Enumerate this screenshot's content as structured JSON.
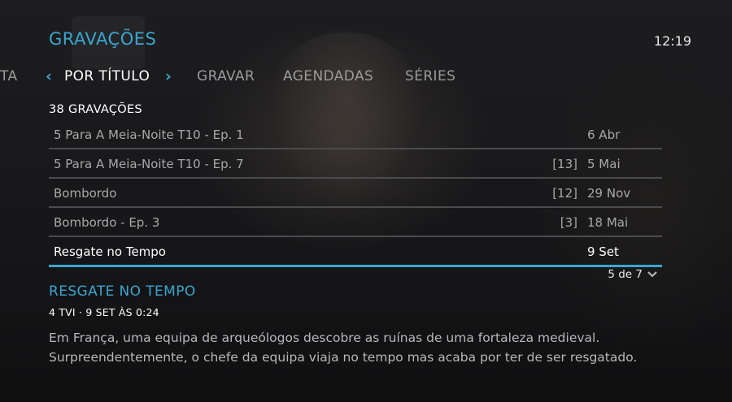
{
  "header": {
    "title": "GRAVAÇÕES",
    "clock": "12:19"
  },
  "tabs": {
    "prev_partial": "TA",
    "left_arrow": "‹",
    "active": "POR TÍTULO",
    "right_arrow": "›",
    "items": [
      "GRAVAR",
      "AGENDADAS",
      "SÉRIES"
    ]
  },
  "list": {
    "count_label": "38 GRAVAÇÕES",
    "rows": [
      {
        "title": "5 Para A Meia-Noite T10 - Ep. 1",
        "episodes": "",
        "date": "6 Abr"
      },
      {
        "title": "5 Para A Meia-Noite T10 - Ep. 7",
        "episodes": "[13]",
        "date": "5 Mai"
      },
      {
        "title": "Bombordo",
        "episodes": "[12]",
        "date": "29 Nov"
      },
      {
        "title": "Bombordo - Ep. 3",
        "episodes": "[3]",
        "date": "18 Mai"
      },
      {
        "title": "Resgate no Tempo",
        "episodes": "",
        "date": "9 Set"
      }
    ],
    "selected_index": 4,
    "pager": "5 de 7"
  },
  "detail": {
    "title": "RESGATE NO TEMPO",
    "meta": "4 TVI · 9 SET ÀS 0:24",
    "description_line1": "Em França, uma equipa de arqueólogos descobre as ruínas de uma fortaleza medieval.",
    "description_line2": "Surpreendentemente, o chefe da equipa viaja no tempo mas acaba por ter de ser resgatado."
  },
  "icons": {
    "pager_icon": "chevron-down-icon",
    "tab_prev_icon": "chevron-left-icon",
    "tab_next_icon": "chevron-right-icon"
  },
  "colors": {
    "accent": "#3aa6cf",
    "text_primary": "#ffffff",
    "text_secondary": "#a8a8a8",
    "divider": "#4b4b4e"
  }
}
